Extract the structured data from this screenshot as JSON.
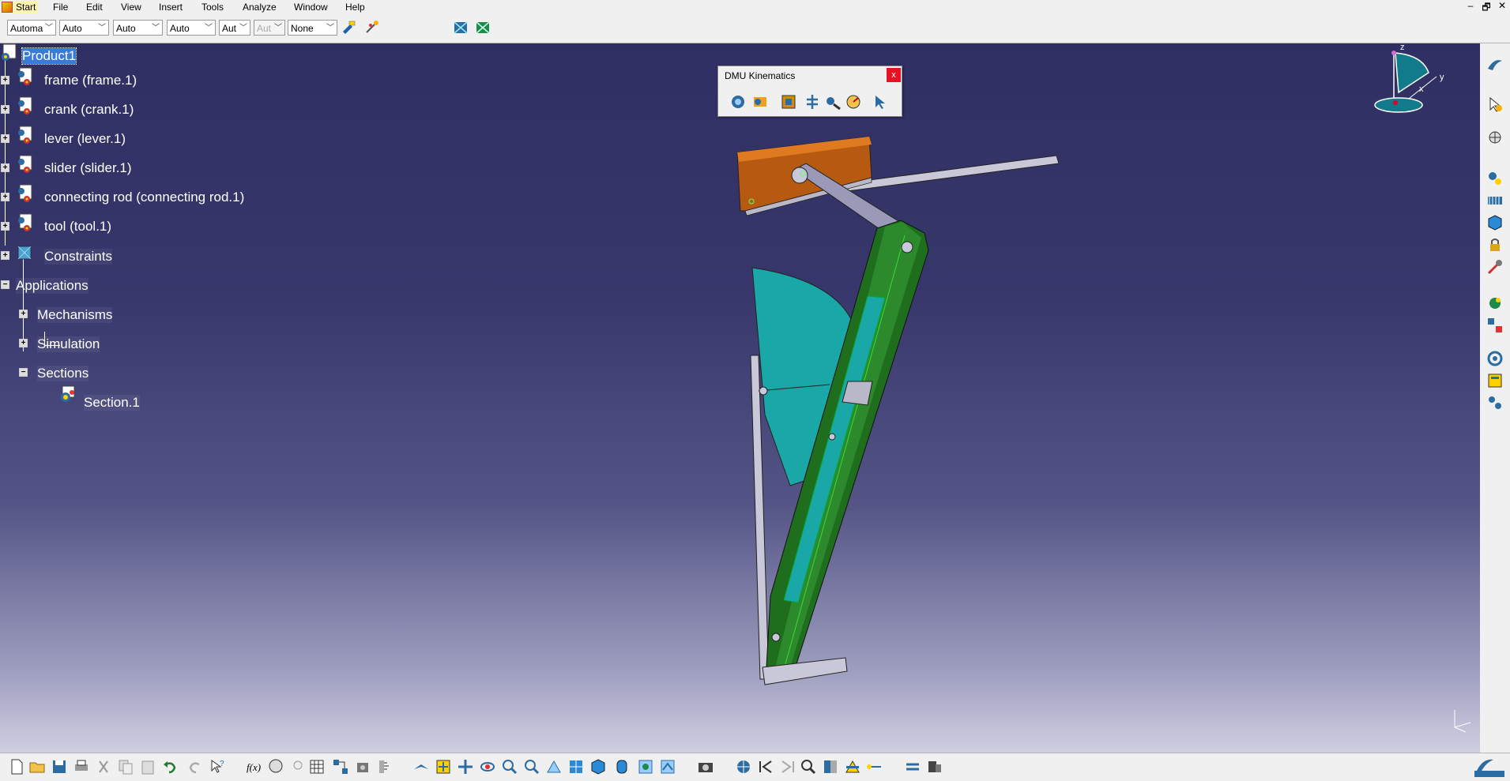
{
  "menu": {
    "items": [
      "Start",
      "File",
      "Edit",
      "View",
      "Insert",
      "Tools",
      "Analyze",
      "Window",
      "Help"
    ],
    "window_controls": [
      "–",
      "🗗",
      "✕"
    ]
  },
  "toolbar": {
    "combos": [
      "Automa",
      "Auto",
      "Auto",
      "Auto",
      "Aut",
      "Aut",
      "None"
    ]
  },
  "tree": {
    "root": "Product1",
    "parts": [
      "frame (frame.1)",
      "crank (crank.1)",
      "lever (lever.1)",
      "slider (slider.1)",
      "connecting rod (connecting rod.1)",
      "tool (tool.1)"
    ],
    "constraints": "Constraints",
    "applications": "Applications",
    "app_children": [
      "Mechanisms",
      "Simulation",
      "Sections"
    ],
    "section": "Section.1"
  },
  "dmu_toolbar": {
    "title": "DMU Kinematics",
    "close": "x"
  },
  "compass": {
    "z": "z",
    "y": "y",
    "x": "x"
  },
  "colors": {
    "frame": "#d06a10",
    "crank": "#9e9ec6",
    "lever": "#1e6e1e",
    "disc": "#1aa7a7",
    "slider": "#c8c8d8"
  }
}
